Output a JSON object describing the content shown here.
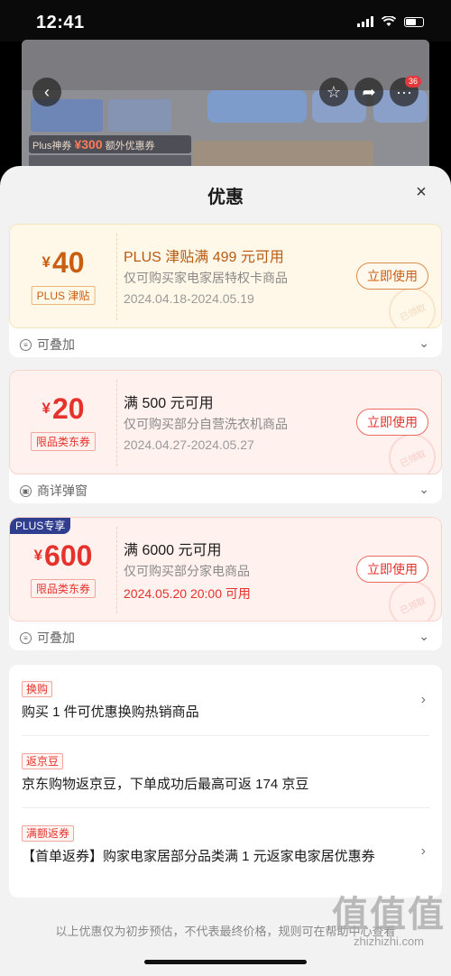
{
  "status": {
    "time": "12:41"
  },
  "background_page": {
    "promo_pill_prefix": "Plus神券",
    "promo_pill_amount": "¥300",
    "promo_pill_suffix": "额外优惠券",
    "cart_badge": "36"
  },
  "sheet": {
    "title": "优惠",
    "close_label": "×"
  },
  "coupons": [
    {
      "amount": "40",
      "currency": "¥",
      "tag": "PLUS 津贴",
      "title": "PLUS 津贴满 499 元可用",
      "desc": "仅可购买家电家居特权卡商品",
      "date": "2024.04.18-2024.05.19",
      "button": "立即使用",
      "stamp": "已领取",
      "footer": "可叠加",
      "ribbon": ""
    },
    {
      "amount": "20",
      "currency": "¥",
      "tag": "限品类东券",
      "title": "满 500 元可用",
      "desc": "仅可购买部分自营洗衣机商品",
      "date": "2024.04.27-2024.05.27",
      "button": "立即使用",
      "stamp": "已领取",
      "footer": "商详弹窗",
      "ribbon": ""
    },
    {
      "amount": "600",
      "currency": "¥",
      "tag": "限品类东券",
      "title": "满 6000 元可用",
      "desc": "仅可购买部分家电商品",
      "date": "2024.05.20 20:00 可用",
      "button": "立即使用",
      "stamp": "已领取",
      "footer": "可叠加",
      "ribbon": "PLUS专享"
    }
  ],
  "promotions": [
    {
      "tag": "换购",
      "text": "购买 1 件可优惠换购热销商品"
    },
    {
      "tag": "返京豆",
      "text": "京东购物返京豆，下单成功后最高可返 174 京豆"
    },
    {
      "tag": "满额返券",
      "text": "【首单返券】购家电家居部分品类满 1 元返家电家居优惠券"
    }
  ],
  "disclaimer": "以上优惠仅为初步预估，不代表最终价格，规则可在帮助中心查看",
  "watermark": {
    "big": "值值值",
    "small": "zhizhizhi.com"
  },
  "colors": {
    "accent_red": "#e6322c",
    "plus_gold": "#c85e12",
    "plus_blue": "#2f3e8f"
  }
}
